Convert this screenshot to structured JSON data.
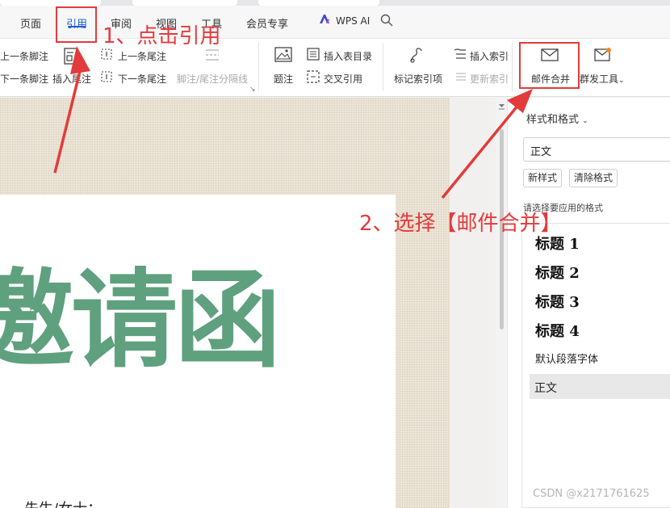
{
  "menubar": {
    "items": [
      "页面",
      "引用",
      "审阅",
      "视图",
      "工具",
      "会员专享"
    ],
    "wps_ai": "WPS AI",
    "active_index": 1,
    "accent_color": "#1f5fd6"
  },
  "ribbon": {
    "prev_footnote": "上一条脚注",
    "next_footnote": "下一条脚注",
    "insert_endnote": "插入尾注",
    "prev_endnote": "上一条尾注",
    "next_endnote": "下一条尾注",
    "separator": "脚注/尾注分隔线",
    "caption": "题注",
    "insert_table_of_figures": "插入表目录",
    "cross_reference": "交叉引用",
    "mark_index_entry": "标记索引项",
    "insert_index": "插入索引",
    "update_index": "更新索引",
    "mail_merge": "邮件合并",
    "bulk_send": "群发工具"
  },
  "document": {
    "title_text": "邀请函",
    "bottom_text": "先生/女士："
  },
  "styles_pane": {
    "title": "样式和格式",
    "current_style": "正文",
    "new_style": "新样式",
    "clear_format": "清除格式",
    "hint": "请选择要应用的格式",
    "headings": [
      "标题  1",
      "标题  2",
      "标题  3",
      "标题  4"
    ],
    "default_font": "默认段落字体",
    "normal": "正文"
  },
  "annotations": {
    "step1": "1、点击引用",
    "step2": "2、选择【邮件合并】",
    "color": "#e33b3b"
  },
  "watermark": "CSDN @x2171761625",
  "icons": [
    "wps-ai-logo",
    "search-icon",
    "footnote-icon",
    "insert-endnote-icon",
    "caption-icon",
    "table-of-figures-icon",
    "cross-reference-icon",
    "mark-index-icon",
    "insert-index-icon",
    "update-index-icon",
    "mail-merge-envelope-icon",
    "bulk-send-icon"
  ]
}
